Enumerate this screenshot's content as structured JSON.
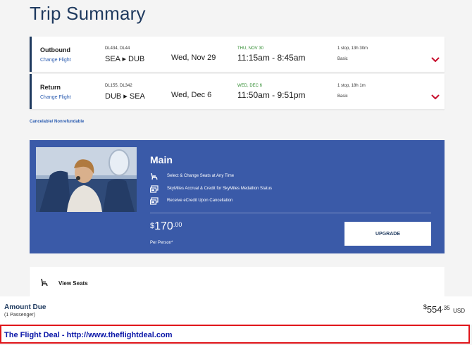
{
  "page": {
    "title": "Trip Summary"
  },
  "flights": [
    {
      "type": "Outbound",
      "change_label": "Change Flight",
      "flight_numbers": "DL434, DL44",
      "route": "SEA ▸ DUB",
      "depart_date": "Wed, Nov 29",
      "arrive_date": "THU, NOV 30",
      "times": "11:15am - 8:45am",
      "stops": "1 stop, 13h 30m",
      "fare": "Basic"
    },
    {
      "type": "Return",
      "change_label": "Change Flight",
      "flight_numbers": "DL155, DL342",
      "route": "DUB ▸ SEA",
      "depart_date": "Wed, Dec 6",
      "arrive_date": "WED, DEC 6",
      "times": "11:50am - 9:51pm",
      "stops": "1 stop, 18h 1m",
      "fare": "Basic"
    }
  ],
  "cancel_note": "Cancelable/ Nonrefundable",
  "promo": {
    "title": "Main",
    "features": [
      {
        "icon": "seat-icon",
        "text": "Select & Change Seats at Any Time"
      },
      {
        "icon": "ticket-icon",
        "text": "SkyMiles Accrual & Credit for SkyMiles Medallion Status"
      },
      {
        "icon": "ticket-icon",
        "text": "Receive eCredit Upon Cancellation"
      }
    ],
    "price_currency": "$",
    "price_amount": "170",
    "price_cents": ".00",
    "price_note": "Per Person*",
    "upgrade_label": "UPGRADE"
  },
  "seats": {
    "label": "View Seats",
    "icon": "seat-icon"
  },
  "amount_due": {
    "label": "Amount Due",
    "passengers": "(1 Passenger)",
    "currency": "$",
    "amount": "554",
    "cents": ".35",
    "code": "USD"
  },
  "watermark": {
    "text": "The Flight Deal - http://www.theflightdeal.com"
  },
  "colors": {
    "brand_navy": "#1f3a5f",
    "link_blue": "#2b5cb0",
    "promo_blue": "#3a5aa8",
    "chevron_red": "#c8102e",
    "arrival_green": "#2e8b2e",
    "watermark_border": "#e0161b",
    "watermark_text": "#0b17a8"
  }
}
